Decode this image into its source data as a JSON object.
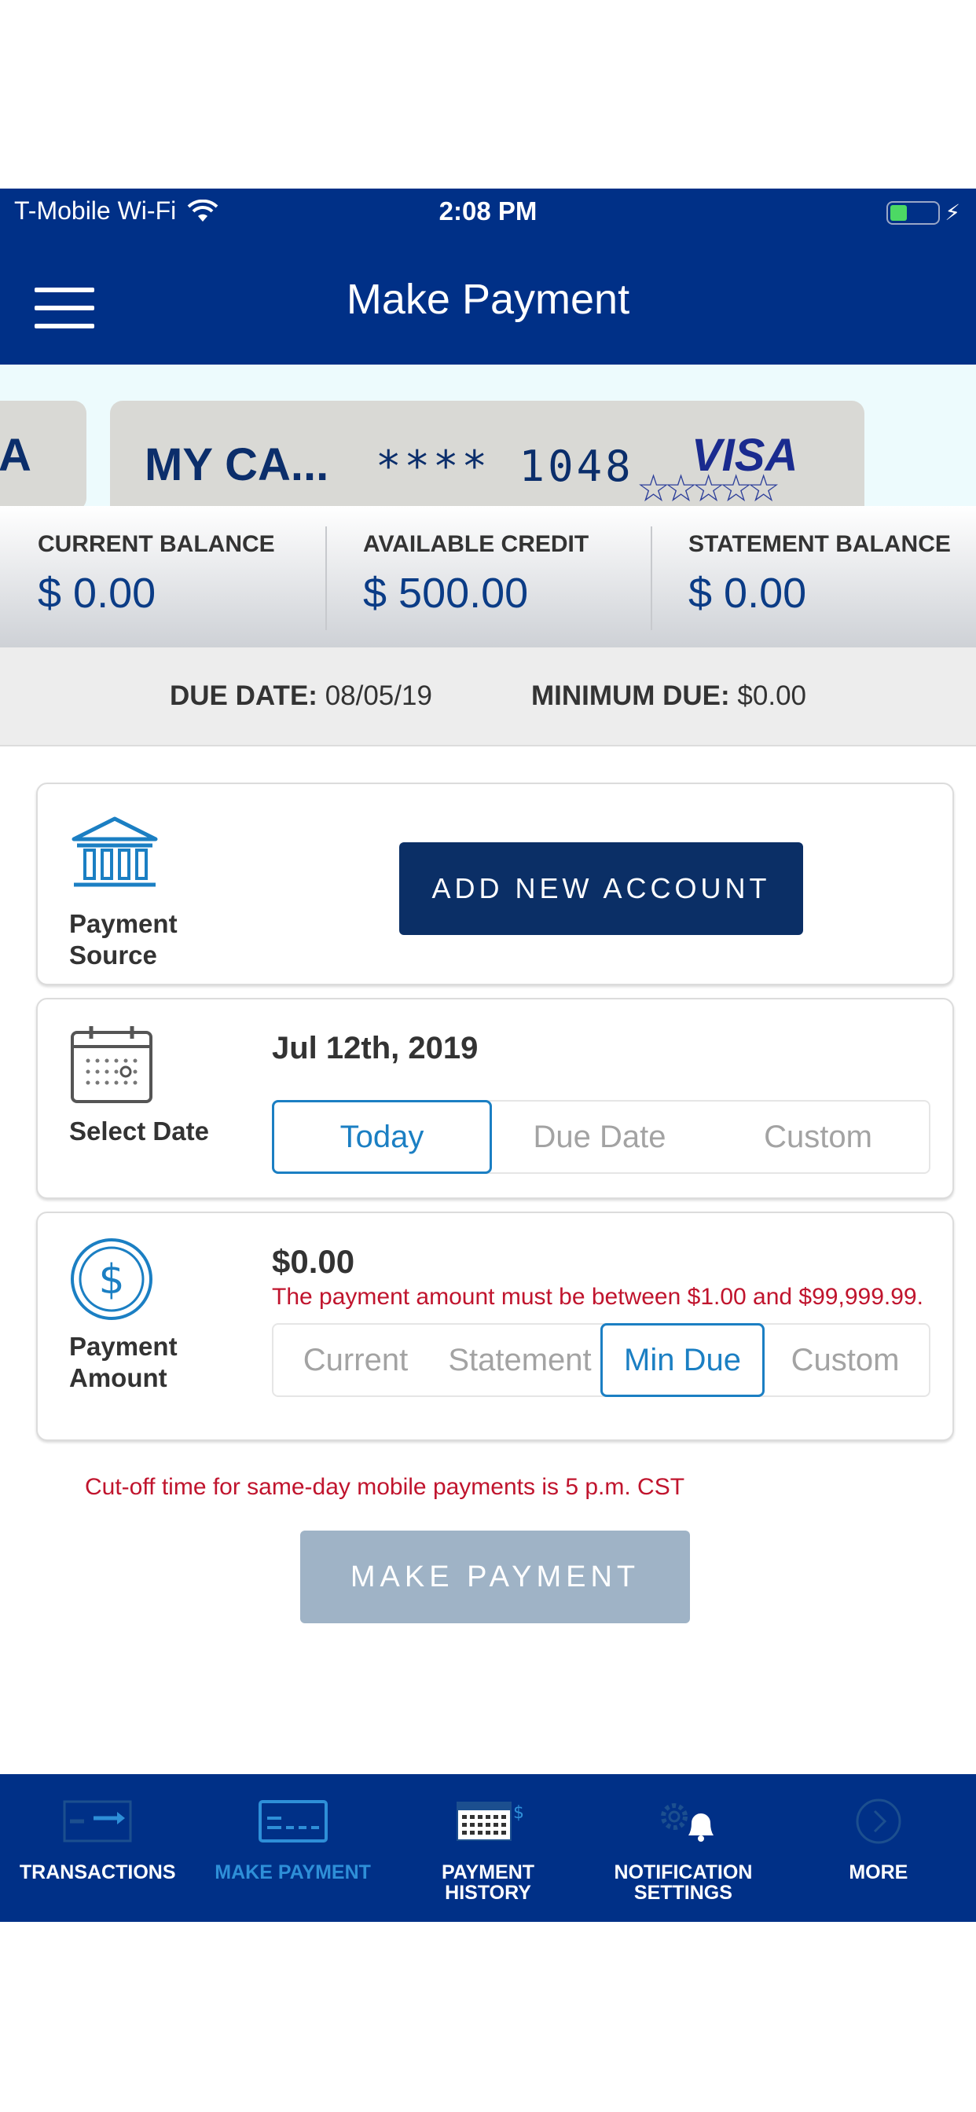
{
  "status_bar": {
    "carrier": "T-Mobile Wi-Fi",
    "time": "2:08 PM"
  },
  "header": {
    "title": "Make Payment"
  },
  "cards": {
    "left_partial_text": "A",
    "main_name": "MY CA...",
    "main_number": "**** 1048",
    "main_logo": "VISA"
  },
  "balances": [
    {
      "label": "CURRENT BALANCE",
      "value": "$ 0.00"
    },
    {
      "label": "AVAILABLE CREDIT",
      "value": "$ 500.00"
    },
    {
      "label": "STATEMENT BALANCE",
      "value": "$ 0.00"
    }
  ],
  "due": {
    "due_date_label": "DUE DATE:",
    "due_date_value": "08/05/19",
    "min_due_label": "MINIMUM DUE:",
    "min_due_value": "$0.00"
  },
  "payment_source": {
    "label": "Payment Source",
    "label_line1": "Payment",
    "label_line2": "Source",
    "add_button": "ADD NEW ACCOUNT",
    "icon": "bank-icon"
  },
  "select_date": {
    "label": "Select Date",
    "date": "Jul 12th, 2019",
    "options": [
      "Today",
      "Due Date",
      "Custom"
    ],
    "selected": "Today",
    "icon": "calendar-icon"
  },
  "payment_amount": {
    "label_line1": "Payment",
    "label_line2": "Amount",
    "amount": "$0.00",
    "error": "The payment amount must be between $1.00 and $99,999.99.",
    "options": [
      "Current",
      "Statement",
      "Min Due",
      "Custom"
    ],
    "selected": "Min Due",
    "icon": "dollar-icon"
  },
  "cutoff_notice": "Cut-off time for same-day mobile payments is 5 p.m. CST",
  "make_payment_button": "MAKE PAYMENT",
  "tabs": [
    {
      "label": "TRANSACTIONS",
      "icon": "transactions-icon"
    },
    {
      "label": "MAKE PAYMENT",
      "icon": "card-icon",
      "active": true
    },
    {
      "label": "PAYMENT\nHISTORY",
      "icon": "calendar-dollar-icon"
    },
    {
      "label": "NOTIFICATION\nSETTINGS",
      "icon": "gear-bell-icon"
    },
    {
      "label": "MORE",
      "icon": "chevron-right-circle-icon"
    }
  ],
  "colors": {
    "brand_navy": "#003087",
    "accent_blue": "#1b7fc3",
    "error_red": "#c0142d",
    "disabled_button": "#9fb3c6"
  }
}
